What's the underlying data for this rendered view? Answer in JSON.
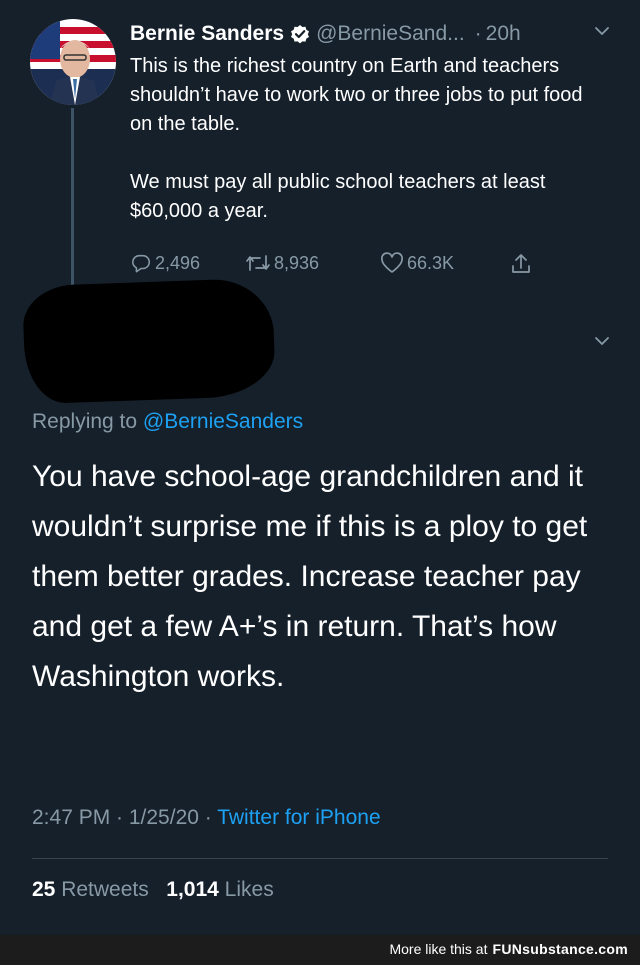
{
  "tweet": {
    "author_name": "Bernie Sanders",
    "handle": "@BernieSand...",
    "time": "20h",
    "paragraphs": [
      "This is the richest country on Earth and teachers shouldn’t have to work two or three jobs to put food on the table.",
      "We must pay all public school teachers at least $60,000 a year."
    ],
    "actions": {
      "replies": "2,496",
      "retweets": "8,936",
      "likes": "66.3K"
    },
    "icons": {
      "verified": "verified-badge-icon",
      "reply": "reply-icon",
      "retweet": "retweet-icon",
      "like": "heart-icon",
      "share": "share-icon",
      "menu": "chevron-down-icon"
    }
  },
  "reply": {
    "replying_prefix": "Replying to",
    "replying_mention": "@BernieSanders",
    "text": "You have school-age grandchildren and it wouldn’t surprise me if this is a ploy to get them better grades. Increase teacher pay and get a few A+’s in return. That’s how Washington works.",
    "timestamp": "2:47 PM · 1/25/20 · ",
    "source": "Twitter for iPhone",
    "retweets_count": "25",
    "retweets_label": "Retweets",
    "likes_count": "1,014",
    "likes_label": "Likes"
  },
  "footer": {
    "prefix": "More like this at",
    "brand": "FUNsubstance.com"
  },
  "colors": {
    "background": "#15202b",
    "accent": "#1da1f2",
    "muted": "#8899a6"
  }
}
